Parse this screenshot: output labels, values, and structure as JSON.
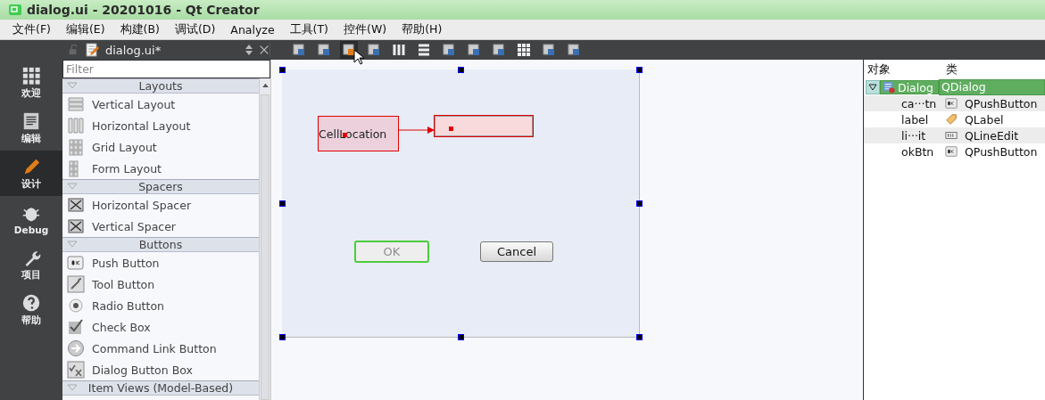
{
  "window": {
    "title": "dialog.ui - 20201016 - Qt Creator"
  },
  "menu": [
    "文件(F)",
    "编辑(E)",
    "构建(B)",
    "调试(D)",
    "Analyze",
    "工具(T)",
    "控件(W)",
    "帮助(H)"
  ],
  "modes": [
    {
      "label": "欢迎",
      "selected": false
    },
    {
      "label": "编辑",
      "selected": false
    },
    {
      "label": "设计",
      "selected": true
    },
    {
      "label": "Debug",
      "selected": false
    },
    {
      "label": "项目",
      "selected": false
    },
    {
      "label": "帮助",
      "selected": false
    }
  ],
  "editor_bar": {
    "file": "dialog.ui*"
  },
  "widget_box": {
    "filter_placeholder": "Filter",
    "categories": [
      {
        "title": "Layouts",
        "items": [
          "Vertical Layout",
          "Horizontal Layout",
          "Grid Layout",
          "Form Layout"
        ]
      },
      {
        "title": "Spacers",
        "items": [
          "Horizontal Spacer",
          "Vertical Spacer"
        ]
      },
      {
        "title": "Buttons",
        "items": [
          "Push Button",
          "Tool Button",
          "Radio Button",
          "Check Box",
          "Command Link Button",
          "Dialog Button Box"
        ]
      },
      {
        "title": "Item Views (Model-Based)"
      }
    ]
  },
  "form": {
    "label": "CellLocation",
    "ok_button": {
      "text": "OK",
      "disabled": true
    },
    "cancel_button": {
      "text": "Cancel",
      "disabled": false
    }
  },
  "object_inspector": {
    "columns": [
      "对象",
      "类"
    ],
    "tree": [
      {
        "object": "Dialog",
        "class": "QDialog",
        "selected": true,
        "expanded": true,
        "children": [
          {
            "object": "ca···tn",
            "class": "QPushButton",
            "selected": false
          },
          {
            "object": "label",
            "class": "QLabel",
            "selected": false
          },
          {
            "object": "li···it",
            "class": "QLineEdit",
            "selected": false
          },
          {
            "object": "okBtn",
            "class": "QPushButton",
            "selected": false
          }
        ]
      }
    ]
  }
}
